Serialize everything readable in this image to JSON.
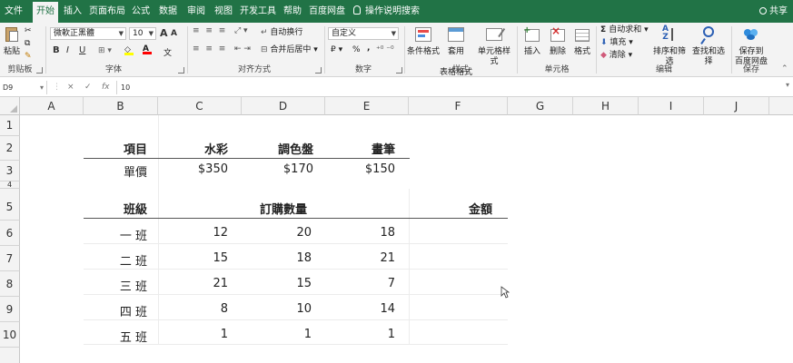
{
  "tabs": [
    {
      "label": "文件",
      "active": false
    },
    {
      "label": "开始",
      "active": true
    },
    {
      "label": "插入",
      "active": false
    },
    {
      "label": "页面布局",
      "active": false
    },
    {
      "label": "公式",
      "active": false
    },
    {
      "label": "数据",
      "active": false
    },
    {
      "label": "审阅",
      "active": false
    },
    {
      "label": "视图",
      "active": false
    },
    {
      "label": "开发工具",
      "active": false
    },
    {
      "label": "帮助",
      "active": false
    },
    {
      "label": "百度网盘",
      "active": false
    }
  ],
  "tell_me": "操作说明搜索",
  "share": "共享",
  "ribbon": {
    "clipboard": {
      "paste": "粘贴",
      "group": "剪贴板"
    },
    "font": {
      "name": "微軟正黑體",
      "size": "10",
      "group": "字体",
      "bold": "B",
      "italic": "I",
      "underline": "U",
      "grow": "A",
      "shrink": "A",
      "phonetic": "文"
    },
    "alignment": {
      "wrap": "自动换行",
      "merge": "合并后居中",
      "group": "对齐方式"
    },
    "number": {
      "format": "自定义",
      "group": "数字",
      "percent": "%",
      "comma": ","
    },
    "styles": {
      "conditional": "条件格式",
      "table_top": "套用",
      "table_bottom": "表格格式",
      "cell_styles": "单元格样式",
      "group": "样式"
    },
    "cells": {
      "insert": "插入",
      "delete": "删除",
      "format": "格式",
      "group": "单元格"
    },
    "editing": {
      "autosum": "自动求和",
      "fill": "填充",
      "clear": "清除",
      "sort": "排序和筛选",
      "find": "查找和选择",
      "group": "编辑"
    },
    "save": {
      "button": "保存到百度网盘",
      "line1": "保存到",
      "line2": "百度网盘",
      "group": "保存"
    }
  },
  "formula_bar": {
    "name_box": "D9",
    "cancel": "×",
    "enter": "✓",
    "fx": "fx",
    "value": "10"
  },
  "columns": [
    "A",
    "B",
    "C",
    "D",
    "E",
    "F",
    "G",
    "H",
    "I",
    "J"
  ],
  "rows": [
    "1",
    "2",
    "3",
    "4",
    "5",
    "6",
    "7",
    "8",
    "9",
    "10"
  ],
  "sheet": {
    "price_header": {
      "label": "項目",
      "items": [
        "水彩",
        "調色盤",
        "畫筆"
      ]
    },
    "price_row": {
      "label": "單價",
      "values": [
        "$350",
        "$170",
        "$150"
      ]
    },
    "orders_header": {
      "class_label": "班級",
      "qty_label": "訂購數量",
      "amount_label": "金額"
    },
    "orders": [
      {
        "class": "一 班",
        "values": [
          "12",
          "20",
          "18"
        ]
      },
      {
        "class": "二 班",
        "values": [
          "15",
          "18",
          "21"
        ]
      },
      {
        "class": "三 班",
        "values": [
          "21",
          "15",
          "7"
        ]
      },
      {
        "class": "四 班",
        "values": [
          "8",
          "10",
          "14"
        ]
      },
      {
        "class": "五 班",
        "values": [
          "1",
          "1",
          "1"
        ]
      }
    ]
  },
  "colors": {
    "ribbon_green": "#217346",
    "ribbon_bg": "#f3f3f3",
    "gridline": "#e1e1e1"
  }
}
